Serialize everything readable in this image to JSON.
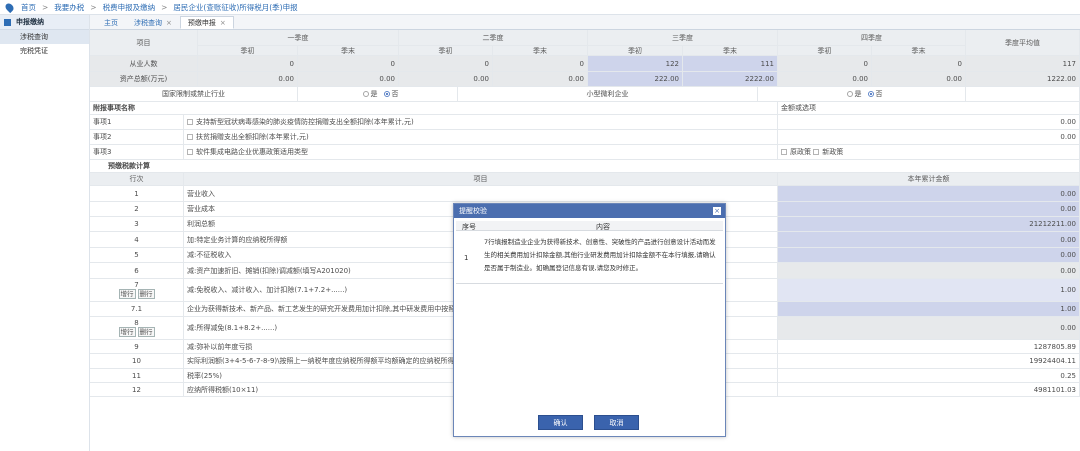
{
  "breadcrumb": [
    "首页",
    "我要办税",
    "税费申报及缴纳",
    "居民企业(查账征收)所得税月(季)申报"
  ],
  "sidebar": {
    "title": "申报缴纳",
    "items": [
      "涉税查询",
      "完税凭证"
    ]
  },
  "tabs": [
    {
      "label": "主页",
      "closable": false
    },
    {
      "label": "涉税查询",
      "closable": true
    },
    {
      "label": "预缴申报",
      "closable": true
    }
  ],
  "header": {
    "item_label": "项目",
    "quarters": [
      "一季度",
      "二季度",
      "三季度",
      "四季度"
    ],
    "start": "季初",
    "end": "季末",
    "avg": "季度平均值"
  },
  "employees": {
    "label": "从业人数",
    "values": [
      "0",
      "0",
      "0",
      "0",
      "122",
      "111",
      "0",
      "0"
    ],
    "avg": "117"
  },
  "assets": {
    "label": "资产总额(万元)",
    "values": [
      "0.00",
      "0.00",
      "0.00",
      "0.00",
      "222.00",
      "2222.00",
      "0.00",
      "0.00"
    ],
    "avg": "1222.00"
  },
  "flags": {
    "restricted_label": "国家限制或禁止行业",
    "small_label": "小型微利企业",
    "yes": "是",
    "no": "否"
  },
  "matters": {
    "title": "附报事项名称",
    "amount_header": "金额或选项",
    "rows": [
      {
        "code": "事项1",
        "text": "支持新型冠状病毒感染的肺炎疫情防控捐赠支出全额扣除(本年累计,元)",
        "value": "0.00"
      },
      {
        "code": "事项2",
        "text": "扶贫捐赠支出全额扣除(本年累计,元)",
        "value": "0.00"
      },
      {
        "code": "事项3",
        "text": "软件集成电路企业优惠政策适用类型",
        "opt1": "原政策",
        "opt2": "新政策"
      }
    ]
  },
  "calc": {
    "title": "预缴税款计算",
    "col_line": "行次",
    "col_item": "项目",
    "col_amount": "本年累计金额",
    "rows": [
      {
        "line": "1",
        "item": "营业收入",
        "value": "0.00"
      },
      {
        "line": "2",
        "item": "营业成本",
        "value": "0.00"
      },
      {
        "line": "3",
        "item": "利润总额",
        "value": "21212211.00"
      },
      {
        "line": "4",
        "item": "加:特定业务计算的应纳税所得额",
        "value": "0.00"
      },
      {
        "line": "5",
        "item": "减:不征税收入",
        "value": "0.00"
      },
      {
        "line": "6",
        "item": "减:资产加速折旧、摊销(扣除)调减额(填写A201020)",
        "value": "0.00"
      },
      {
        "line": "7",
        "item": "减:免税收入、减计收入、加计扣除(7.1+7.2+......)",
        "value": "1.00"
      },
      {
        "line": "7.1",
        "item": "企业为获得新技术、新产品、新工艺发生的研究开发费用加计扣除,其中研发费用中按照税法规定可以加计扣除的部分",
        "value": "1.00"
      },
      {
        "line": "8",
        "item": "减:所得减免(8.1+8.2+......)",
        "value": "0.00"
      },
      {
        "line": "9",
        "item": "减:弥补以前年度亏损",
        "value": "1287805.89"
      },
      {
        "line": "10",
        "item": "实际利润额(3+4-5-6-7-8-9)\\按照上一纳税年度应纳税所得额平均额确定的应纳税所得额",
        "value": "19924404.11"
      },
      {
        "line": "11",
        "item": "税率(25%)",
        "value": "0.25"
      },
      {
        "line": "12",
        "item": "应纳所得税额(10×11)",
        "value": "4981101.03"
      }
    ],
    "add_row": "增行",
    "del_row": "删行"
  },
  "dialog": {
    "title": "提醒校验",
    "col_no": "序号",
    "col_content": "内容",
    "row_no": "1",
    "message": "7行填报制造业企业为获得新技术、创意性、突破性的产品进行创意设计活动而发生的相关费用加计扣除金额,其他行业研发费用加计扣除金额不在本行填报,请确认是否属于制造业。如确属登记信息有误,请您及时修正。",
    "confirm": "确认",
    "cancel": "取消"
  }
}
